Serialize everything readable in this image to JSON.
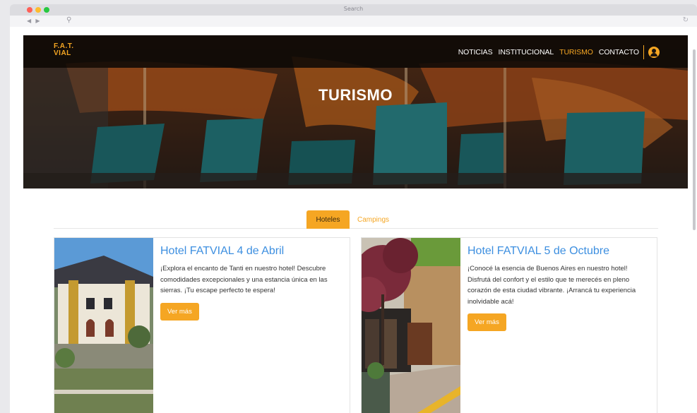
{
  "browser": {
    "address_text": "Search",
    "nav_arrows": "◀ ▶"
  },
  "site": {
    "logo_line1": "F.A.T.",
    "logo_line2": "VIAL",
    "nav": {
      "noticias": "NOTICIAS",
      "institucional": "INSTITUCIONAL",
      "turismo": "TURISMO",
      "contacto": "CONTACTO"
    },
    "hero_title": "TURISMO"
  },
  "tabs": {
    "hoteles": "Hoteles",
    "campings": "Campings",
    "active": "Hoteles"
  },
  "cards": [
    {
      "title": "Hotel FATVIAL 4 de Abril",
      "text": "¡Explora el encanto de Tanti en nuestro hotel! Descubre comodidades excepcionales y una estancia única en las sierras. ¡Tu escape perfecto te espera!",
      "button": "Ver más"
    },
    {
      "title": "Hotel FATVIAL 5 de Octubre",
      "text": "¡Conocé la esencia de Buenos Aires en nuestro hotel! Disfrutá del confort y el estilo que te merecés en pleno corazón de esta ciudad vibrante. ¡Arrancá tu experiencia inolvidable acá!",
      "button": "Ver más"
    }
  ],
  "colors": {
    "accent": "#f5a623",
    "title_blue": "#3d8fe0",
    "nav_bg": "#0a0806"
  }
}
